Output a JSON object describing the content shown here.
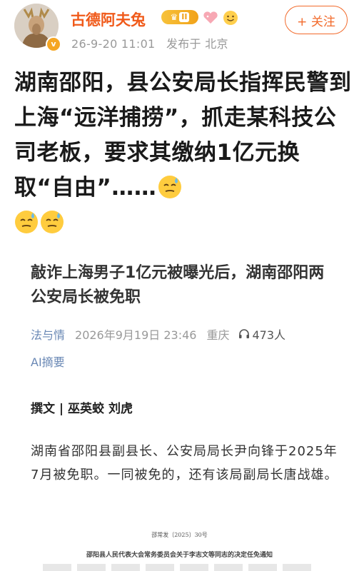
{
  "user": {
    "name": "古德阿夫兔",
    "level": "II",
    "time": "26-9-20 11:01",
    "location": "发布于 北京",
    "verified_mark": "v",
    "follow_label": "+ 关注"
  },
  "post": {
    "text": "湖南邵阳，县公安局长指挥民警到上海“远洋捕捞”，抓走某科技公司老板，要求其缴纳1亿元换取“自由”……",
    "emoji_trailing": "sweat-smile-emoji",
    "emoji_count": 3
  },
  "article": {
    "title": "敲诈上海男子1亿元被曝光后，湖南邵阳两公安局长被免职",
    "source": "法与情",
    "datetime": "2026年9月19日 23:46",
    "location": "重庆",
    "listen_count": "473人",
    "ai_summary": "AI摘要",
    "byline": "撰文 | 巫英蛟 刘虎",
    "body": "湖南省邵阳县副县长、公安局局长尹向锋于2025年7月被免职。一同被免的，还有该局副局长唐战雄。",
    "doc_number": "邵常发〔2025〕30号",
    "doc_title": "邵阳县人民代表大会常务委员会关于李志文等同志的决定任免通知"
  },
  "colors": {
    "name": "#f05a1a",
    "follow": "#f26a2b",
    "meta": "#999999",
    "link": "#6a88b5"
  }
}
